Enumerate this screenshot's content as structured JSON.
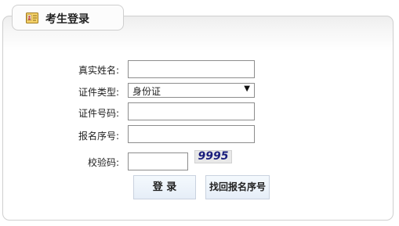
{
  "tab": {
    "title": "考生登录",
    "icon": "id-card-icon"
  },
  "form": {
    "real_name_label": "真实姓名:",
    "id_type_label": "证件类型:",
    "id_type_selected": "身份证",
    "id_number_label": "证件号码:",
    "reg_number_label": "报名序号:",
    "captcha_label": "校验码:",
    "captcha_text": "9995"
  },
  "buttons": {
    "login": "登 录",
    "retrieve": "找回报名序号"
  },
  "colors": {
    "border": "#cfcfcf",
    "captcha_text": "#1a1e7c",
    "button_bg": "#e6eef8"
  }
}
